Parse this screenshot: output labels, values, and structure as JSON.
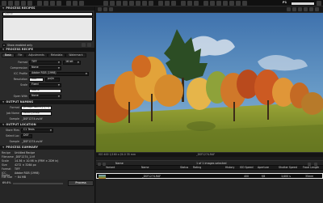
{
  "app": {
    "logo": "P1",
    "top_search_placeholder": ""
  },
  "left": {
    "process_recipes": {
      "header": "PROCESS RECIPES",
      "search_placeholder": "Name",
      "show_enabled": "Show enabled only"
    },
    "process_recipe": {
      "header": "PROCESS RECIPE",
      "tabs": [
        "Basic",
        "File",
        "Adjustments",
        "Metadata",
        "Watermark"
      ],
      "active_tab": "Basic",
      "rows": [
        {
          "label": "Format",
          "value": "TIFF",
          "extra": "16 bit"
        },
        {
          "label": "Compression",
          "value": "None"
        },
        {
          "label": "ICC Profile",
          "value": "Adobe RGB (1998)"
        },
        {
          "label": "Resolution",
          "value": "300",
          "extra": "px/in"
        },
        {
          "label": "Scale",
          "value": "Fixed"
        },
        {
          "label": "",
          "value": "100%"
        },
        {
          "label": "Open With",
          "value": "None"
        }
      ]
    },
    "output_naming": {
      "header": "OUTPUT NAMING",
      "rows": [
        {
          "label": "Format",
          "value": "[Image Name]+[...]"
        },
        {
          "label": "Job Name",
          "value": "Gallerysnap"
        },
        {
          "label": "Sample",
          "value": "_DSF1274.cv.tif"
        }
      ]
    },
    "output_location": {
      "header": "OUTPUT LOCATION",
      "rows": [
        {
          "label": "Store Files",
          "value": "C1 Tests"
        },
        {
          "label": "Select Loc",
          "value": "DSF"
        },
        {
          "label": "Sample",
          "value": "_DSF1274.cv.tif"
        }
      ]
    },
    "process_summary": {
      "header": "PROCESS SUMMARY",
      "rows": [
        {
          "label": "Recipe",
          "value": "Untitled Recipe"
        },
        {
          "label": "Filename",
          "value": "_DSF1274_1.tif"
        },
        {
          "label": "Scale",
          "value": "14.36 × 10.98 in (FRM × 2DH in)"
        },
        {
          "label": "Size",
          "value": "4272 × 3264 px"
        },
        {
          "label": "Format",
          "value": "TIFF"
        },
        {
          "label": "ICC Profile",
          "value": "Adobe RGB (1998)"
        },
        {
          "label": "File Size",
          "value": "~ 84 MB"
        }
      ]
    },
    "bottom": {
      "zoom": "69.6%",
      "process_button": "Process"
    }
  },
  "viewer": {
    "status_left": "ISO 400  1/160 s  f/4.0  35 mm",
    "status_center": "_DSF1274.RAF"
  },
  "browser": {
    "sort_label": "Name",
    "count_label": "1 of 1 images selected",
    "columns": [
      "Variant",
      "Name",
      "Status",
      "Rating",
      "History",
      "ISO Speed",
      "Aperture",
      "Shutter Speed",
      "Focal Length"
    ],
    "row": {
      "variant": "",
      "name": "_DSF1274.RAF",
      "status": "",
      "rating": "",
      "history": "",
      "iso": "400",
      "aperture": "f/8",
      "shutter": "1/400 s",
      "focal": "35mm"
    }
  },
  "colors": {
    "sky": "#4f7fb3",
    "grass": "#8a9a35",
    "accent": "#c8c8c8"
  }
}
